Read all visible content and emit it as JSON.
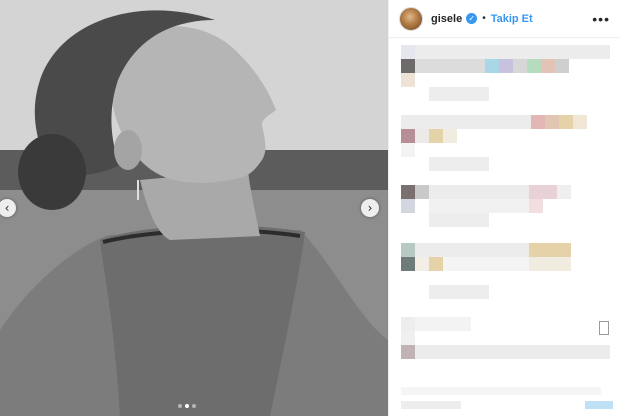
{
  "post": {
    "username": "gisele",
    "verified_icon": "verified-badge-icon",
    "separator": "•",
    "follow_label": "Takip Et",
    "more_icon": "ellipsis-icon",
    "more_glyph": "•••"
  },
  "carousel": {
    "prev_glyph": "‹",
    "next_glyph": "›",
    "slide_count": 3,
    "active_slide": 2,
    "photo_style": "black-and-white portrait"
  },
  "comments_area": {
    "state": "pixelated / obscured",
    "colors": {
      "light_gray": "#e8e8e8",
      "mid_gray": "#d2d2d2",
      "dark_gray": "#7a7474",
      "blue": "#a9d7e8",
      "lavender": "#c8c2df",
      "green": "#b6dcc0",
      "rose": "#e3b6b6",
      "tan": "#e6d2a8",
      "link_blue": "#bfe0f5"
    }
  }
}
